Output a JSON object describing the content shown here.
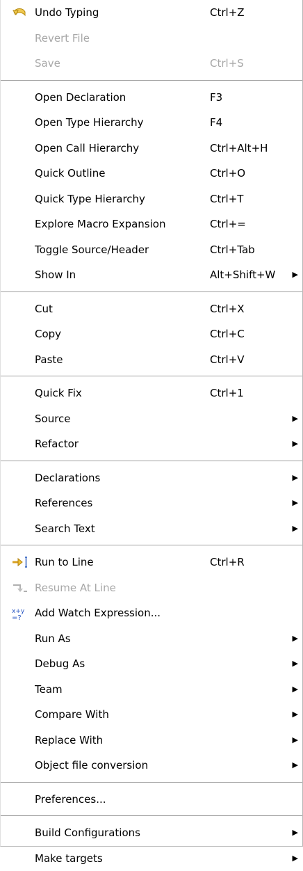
{
  "menu": {
    "undo_typing": {
      "label": "Undo Typing",
      "shortcut": "Ctrl+Z",
      "icon": "undo-icon"
    },
    "revert_file": {
      "label": "Revert File"
    },
    "save": {
      "label": "Save",
      "shortcut": "Ctrl+S"
    },
    "open_declaration": {
      "label": "Open Declaration",
      "shortcut": "F3"
    },
    "open_type_hierarchy": {
      "label": "Open Type Hierarchy",
      "shortcut": "F4"
    },
    "open_call_hierarchy": {
      "label": "Open Call Hierarchy",
      "shortcut": "Ctrl+Alt+H"
    },
    "quick_outline": {
      "label": "Quick Outline",
      "shortcut": "Ctrl+O"
    },
    "quick_type_hierarchy": {
      "label": "Quick Type Hierarchy",
      "shortcut": "Ctrl+T"
    },
    "explore_macro_expansion": {
      "label": "Explore Macro Expansion",
      "shortcut": "Ctrl+="
    },
    "toggle_source_header": {
      "label": "Toggle Source/Header",
      "shortcut": "Ctrl+Tab"
    },
    "show_in": {
      "label": "Show In",
      "shortcut": "Alt+Shift+W"
    },
    "cut": {
      "label": "Cut",
      "shortcut": "Ctrl+X"
    },
    "copy": {
      "label": "Copy",
      "shortcut": "Ctrl+C"
    },
    "paste": {
      "label": "Paste",
      "shortcut": "Ctrl+V"
    },
    "quick_fix": {
      "label": "Quick Fix",
      "shortcut": "Ctrl+1"
    },
    "source": {
      "label": "Source"
    },
    "refactor": {
      "label": "Refactor"
    },
    "declarations": {
      "label": "Declarations"
    },
    "references": {
      "label": "References"
    },
    "search_text": {
      "label": "Search Text"
    },
    "run_to_line": {
      "label": "Run to Line",
      "shortcut": "Ctrl+R",
      "icon": "run-to-line-icon"
    },
    "resume_at_line": {
      "label": "Resume At Line",
      "icon": "resume-at-line-icon"
    },
    "add_watch_expression": {
      "label": "Add Watch Expression...",
      "icon": "watch-expression-icon"
    },
    "run_as": {
      "label": "Run As"
    },
    "debug_as": {
      "label": "Debug As"
    },
    "team": {
      "label": "Team"
    },
    "compare_with": {
      "label": "Compare With"
    },
    "replace_with": {
      "label": "Replace With"
    },
    "object_file_conversion": {
      "label": "Object file conversion"
    },
    "preferences": {
      "label": "Preferences..."
    },
    "build_configurations": {
      "label": "Build Configurations"
    },
    "make_targets": {
      "label": "Make targets"
    },
    "submenu_arrow": "▶"
  }
}
